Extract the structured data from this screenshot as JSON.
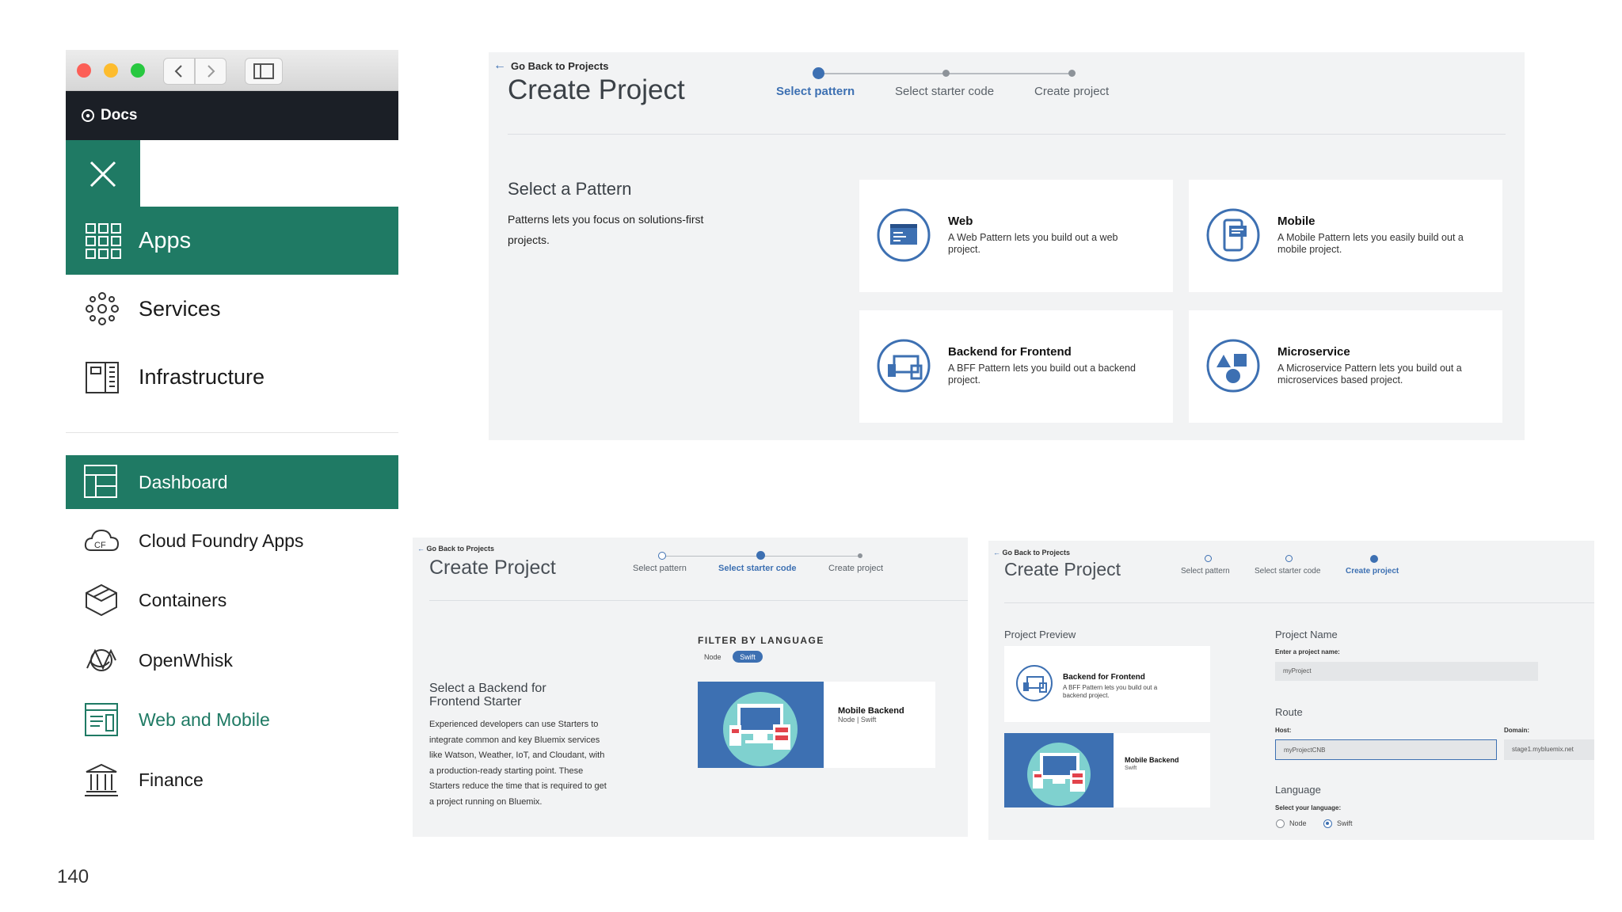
{
  "sidebar": {
    "docs_label": "Docs",
    "apps_label": "Apps",
    "items": [
      {
        "label": "Services",
        "icon": "services-icon"
      },
      {
        "label": "Infrastructure",
        "icon": "infrastructure-icon"
      }
    ],
    "dashboard_label": "Dashboard",
    "sub_items": [
      {
        "label": "Cloud Foundry Apps",
        "icon": "cloud-foundry-icon",
        "badge": "CF"
      },
      {
        "label": "Containers",
        "icon": "containers-icon"
      },
      {
        "label": "OpenWhisk",
        "icon": "openwhisk-icon"
      },
      {
        "label": "Web and Mobile",
        "icon": "web-mobile-icon",
        "selected": true
      },
      {
        "label": "Finance",
        "icon": "finance-icon"
      }
    ],
    "accent_color": "#1f7a64"
  },
  "page_number": "140",
  "main": {
    "back_link": "Go Back to Projects",
    "title": "Create Project",
    "steps": [
      {
        "label": "Select pattern",
        "active": true
      },
      {
        "label": "Select starter code",
        "active": false
      },
      {
        "label": "Create project",
        "active": false
      }
    ],
    "section_title": "Select a Pattern",
    "section_desc": "Patterns lets you focus on solutions-first projects.",
    "patterns": [
      {
        "title": "Web",
        "desc": "A Web Pattern lets you build out a web project.",
        "icon": "web-pattern-icon"
      },
      {
        "title": "Mobile",
        "desc": "A Mobile Pattern lets you easily build out a mobile project.",
        "icon": "mobile-pattern-icon"
      },
      {
        "title": "Backend for Frontend",
        "desc": "A BFF Pattern lets you build out a backend project.",
        "icon": "bff-pattern-icon"
      },
      {
        "title": "Microservice",
        "desc": "A Microservice Pattern lets you build out a microservices based project.",
        "icon": "microservice-pattern-icon"
      }
    ],
    "accent_color": "#3d70b2"
  },
  "starter_panel": {
    "back_link": "Go Back to Projects",
    "title": "Create Project",
    "steps": [
      "Select pattern",
      "Select starter code",
      "Create project"
    ],
    "section_title": "Select a Backend for Frontend Starter",
    "section_desc": "Experienced developers can use Starters to integrate common and key Bluemix services like Watson, Weather, IoT, and Cloudant, with a production-ready starting point. These Starters reduce the time that is required to get a project running on Bluemix.",
    "filter_label": "FILTER BY LANGUAGE",
    "filters": [
      {
        "label": "Node",
        "active": false
      },
      {
        "label": "Swift",
        "active": true
      }
    ],
    "starter": {
      "title": "Mobile Backend",
      "subtitle": "Node | Swift"
    }
  },
  "create_panel": {
    "back_link": "Go Back to Projects",
    "title": "Create Project",
    "steps": [
      "Select pattern",
      "Select starter code",
      "Create project"
    ],
    "preview_label": "Project Preview",
    "preview_pattern": {
      "title": "Backend for Frontend",
      "desc": "A BFF Pattern lets you build out a backend project."
    },
    "preview_starter": {
      "title": "Mobile Backend",
      "subtitle": "Swift"
    },
    "name_label": "Project Name",
    "name_prompt": "Enter a project name:",
    "name_value": "myProject",
    "route_label": "Route",
    "host_label": "Host:",
    "host_value": "myProjectCNB",
    "domain_label": "Domain:",
    "domain_value": "stage1.mybluemix.net",
    "language_label": "Language",
    "language_prompt": "Select your language:",
    "languages": [
      {
        "label": "Node",
        "selected": false
      },
      {
        "label": "Swift",
        "selected": true
      }
    ]
  }
}
